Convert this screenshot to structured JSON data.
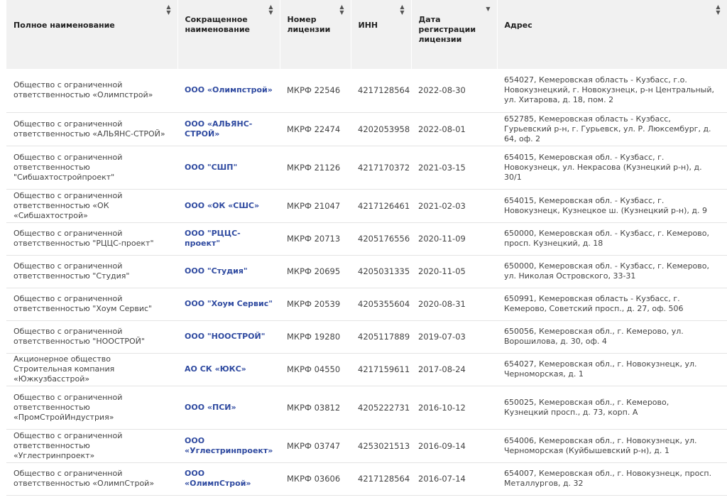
{
  "table": {
    "headers": [
      {
        "label": "Полное наименование",
        "sort": "both"
      },
      {
        "label": "Сокращенное наименование",
        "sort": "both"
      },
      {
        "label": "Номер лицензии",
        "sort": "both"
      },
      {
        "label": "ИНН",
        "sort": "both"
      },
      {
        "label": "Дата регистрации лицензии",
        "sort": "desc"
      },
      {
        "label": "Адрес",
        "sort": "both"
      }
    ],
    "rows": [
      {
        "full": "Общество с ограниченной ответственностью «Олимпстрой»",
        "short": "ООО «Олимпстрой»",
        "license": "МКРФ 22546",
        "inn": "4217128564",
        "date": "2022-08-30",
        "address": "654027, Кемеровская область - Кузбасс, г.о. Новокузнецкий, г. Новокузнецк, р-н Центральный, ул. Хитарова, д. 18, пом. 2"
      },
      {
        "full": "Общество с ограниченной ответственностью «АЛЬЯНС-СТРОЙ»",
        "short": "ООО «АЛЬЯНС-СТРОЙ»",
        "license": "МКРФ 22474",
        "inn": "4202053958",
        "date": "2022-08-01",
        "address": "652785, Кемеровская область - Кузбасс, Гурьевский р-н, г. Гурьевск, ул. Р. Люксембург, д. 64, оф. 2"
      },
      {
        "full": "Общество с ограниченной ответственностью \"Сибшахтостройпроект\"",
        "short": "ООО \"СШП\"",
        "license": "МКРФ 21126",
        "inn": "4217170372",
        "date": "2021-03-15",
        "address": "654015, Кемеровская обл. - Кузбасс, г. Новокузнецк, ул. Некрасова (Кузнецкий р-н), д. 30/1"
      },
      {
        "full": "Общество с ограниченной ответственностью «ОК «Сибшахтострой»",
        "short": "ООО «ОК «СШС»",
        "license": "МКРФ 21047",
        "inn": "4217126461",
        "date": "2021-02-03",
        "address": "654015, Кемеровская обл. - Кузбасс, г. Новокузнецк, Кузнецкое ш. (Кузнецкий р-н), д. 9"
      },
      {
        "full": "Общество с ограниченной ответственностью \"РЦЦС-проект\"",
        "short": "ООО \"РЦЦС-проект\"",
        "license": "МКРФ 20713",
        "inn": "4205176556",
        "date": "2020-11-09",
        "address": "650000, Кемеровская обл. - Кузбасс, г. Кемерово, просп. Кузнецкий, д. 18"
      },
      {
        "full": "Общество с ограниченной ответственностью \"Студия\"",
        "short": "ООО \"Студия\"",
        "license": "МКРФ 20695",
        "inn": "4205031335",
        "date": "2020-11-05",
        "address": "650000, Кемеровская обл. - Кузбасс, г. Кемерово, ул. Николая Островского, 33-31"
      },
      {
        "full": "Общество с ограниченной ответственностью \"Хоум Сервис\"",
        "short": "ООО \"Хоум Сервис\"",
        "license": "МКРФ 20539",
        "inn": "4205355604",
        "date": "2020-08-31",
        "address": "650991, Кемеровская область - Кузбасс, г. Кемерово, Советский просп., д. 27, оф. 506"
      },
      {
        "full": "Общество с ограниченной ответственностью \"НООСТРОЙ\"",
        "short": "ООО \"НООСТРОЙ\"",
        "license": "МКРФ 19280",
        "inn": "4205117889",
        "date": "2019-07-03",
        "address": "650056, Кемеровская обл., г. Кемерово, ул. Ворошилова, д. 30, оф. 4"
      },
      {
        "full": "Акционерное общество Строительная компания «Южкузбасстрой»",
        "short": "АО СК «ЮКС»",
        "license": "МКРФ 04550",
        "inn": "4217159611",
        "date": "2017-08-24",
        "address": "654027, Кемеровская обл., г. Новокузнецк, ул. Черноморская, д. 1"
      },
      {
        "full": "Общество с ограниченной ответственностью «ПромСтройИндустрия»",
        "short": "ООО «ПСИ»",
        "license": "МКРФ 03812",
        "inn": "4205222731",
        "date": "2016-10-12",
        "address": "650025, Кемеровская обл., г. Кемерово, Кузнецкий просп., д. 73, корп. А"
      },
      {
        "full": "Общество с ограниченной ответственностью «Углестринпроект»",
        "short": "ООО «Углестринпроект»",
        "license": "МКРФ 03747",
        "inn": "4253021513",
        "date": "2016-09-14",
        "address": "654006, Кемеровская обл., г. Новокузнецк, ул. Черноморская (Куйбышевский р-н), д. 1"
      },
      {
        "full": "Общество с ограниченной ответственностью «ОлимпСтрой»",
        "short": "ООО «ОлимпСтрой»",
        "license": "МКРФ 03606",
        "inn": "4217128564",
        "date": "2016-07-14",
        "address": "654007, Кемеровская обл., г. Новокузнецк, просп. Металлургов, д. 32"
      }
    ]
  }
}
